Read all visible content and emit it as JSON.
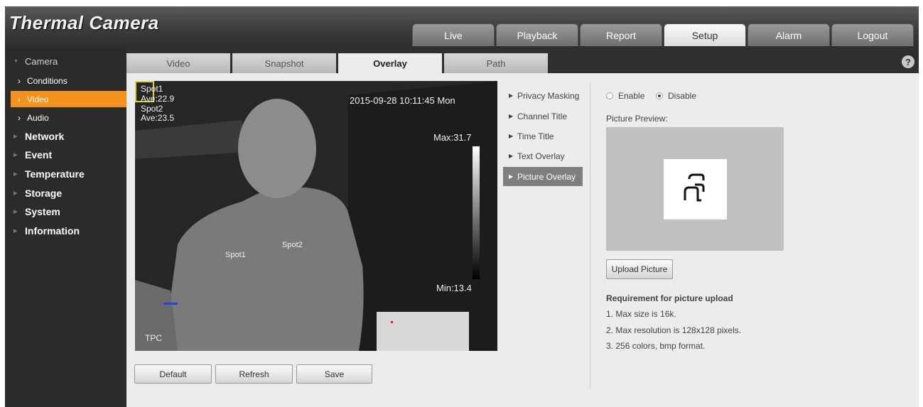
{
  "header": {
    "title": "Thermal Camera"
  },
  "topnav": [
    "Live",
    "Playback",
    "Report",
    "Setup",
    "Alarm",
    "Logout"
  ],
  "topnav_active": "Setup",
  "sidebar": {
    "camera": "Camera",
    "camera_items": [
      "Conditions",
      "Video",
      "Audio"
    ],
    "active_item": "Video",
    "categories": [
      "Network",
      "Event",
      "Temperature",
      "Storage",
      "System",
      "Information"
    ]
  },
  "tabs": [
    "Video",
    "Snapshot",
    "Overlay",
    "Path"
  ],
  "active_tab": "Overlay",
  "video": {
    "spot1_label": "Spot1",
    "spot1_ave": "Ave:22.9",
    "spot2_label": "Spot2",
    "spot2_ave": "Ave:23.5",
    "timestamp": "2015-09-28 10:11:45 Mon",
    "max": "Max:31.7",
    "min": "Min:13.4",
    "marker1": "Spot1",
    "marker2": "Spot2",
    "channel": "TPC"
  },
  "buttons": {
    "default": "Default",
    "refresh": "Refresh",
    "save": "Save"
  },
  "overlay_menu": [
    "Privacy Masking",
    "Channel Title",
    "Time Title",
    "Text Overlay",
    "Picture Overlay"
  ],
  "overlay_active": "Picture Overlay",
  "panel": {
    "enable": "Enable",
    "disable": "Disable",
    "selected": "Disable",
    "preview_label": "Picture Preview:",
    "upload": "Upload Picture",
    "req_title": "Requirement for picture upload",
    "req": [
      "1. Max size is 16k.",
      "2. Max resolution is 128x128 pixels.",
      "3. 256 colors, bmp format."
    ]
  }
}
